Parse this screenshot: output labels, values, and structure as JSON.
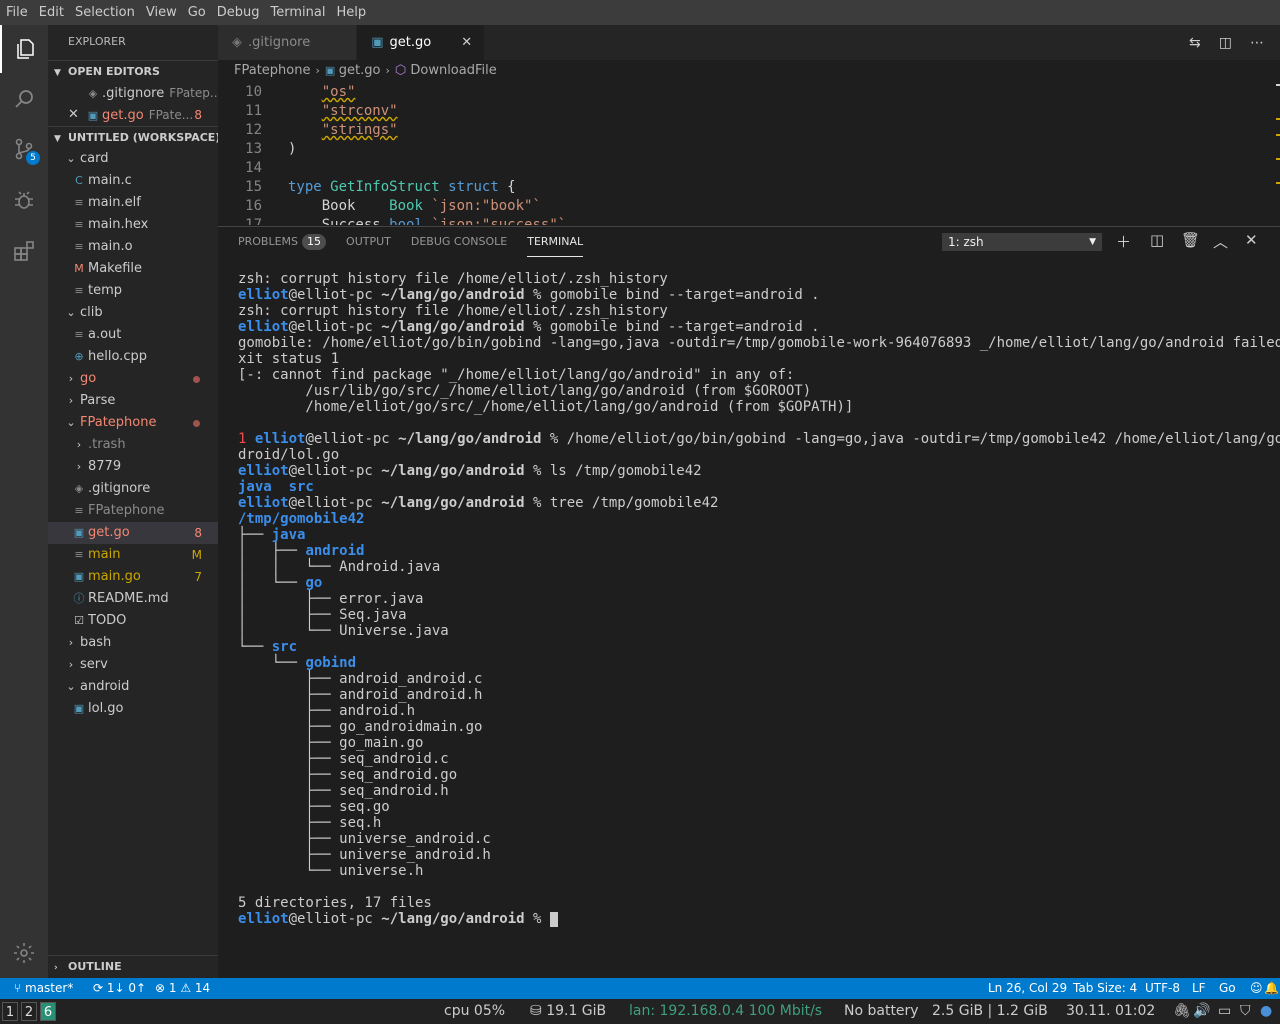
{
  "menu": [
    "File",
    "Edit",
    "Selection",
    "View",
    "Go",
    "Debug",
    "Terminal",
    "Help"
  ],
  "activity": {
    "scm_badge": "5"
  },
  "sidebar": {
    "title": "EXPLORER",
    "open_editors_title": "OPEN EDITORS",
    "open_editors": [
      {
        "name": ".gitignore",
        "dir": "FPatep..."
      },
      {
        "name": "get.go",
        "dir": "FPate...",
        "badge": "8"
      }
    ],
    "workspace_title": "UNTITLED (WORKSPACE)",
    "outline_title": "OUTLINE",
    "tree": [
      {
        "label": "card",
        "type": "folder-open",
        "indent": 1
      },
      {
        "label": "main.c",
        "type": "c",
        "indent": 2
      },
      {
        "label": "main.elf",
        "type": "file",
        "indent": 2
      },
      {
        "label": "main.hex",
        "type": "file",
        "indent": 2
      },
      {
        "label": "main.o",
        "type": "file",
        "indent": 2
      },
      {
        "label": "Makefile",
        "type": "make",
        "indent": 2
      },
      {
        "label": "temp",
        "type": "file",
        "indent": 2
      },
      {
        "label": "clib",
        "type": "folder-open",
        "indent": 1
      },
      {
        "label": "a.out",
        "type": "file",
        "indent": 2
      },
      {
        "label": "hello.cpp",
        "type": "cpp",
        "indent": 2
      },
      {
        "label": "go",
        "type": "folder",
        "indent": 1,
        "status": "dot",
        "color": "red"
      },
      {
        "label": "Parse",
        "type": "folder",
        "indent": 1
      },
      {
        "label": "FPatephone",
        "type": "folder-open",
        "indent": 1,
        "status": "dot",
        "color": "red"
      },
      {
        "label": ".trash",
        "type": "folder",
        "indent": 2,
        "color": "gray"
      },
      {
        "label": "8779",
        "type": "folder",
        "indent": 2
      },
      {
        "label": ".gitignore",
        "type": "git",
        "indent": 2
      },
      {
        "label": "FPatephone",
        "type": "file",
        "indent": 2,
        "color": "gray"
      },
      {
        "label": "get.go",
        "type": "go",
        "indent": 2,
        "color": "red",
        "badge": "8",
        "selected": true
      },
      {
        "label": "main",
        "type": "file",
        "indent": 2,
        "color": "yel",
        "badge": "M"
      },
      {
        "label": "main.go",
        "type": "go",
        "indent": 2,
        "color": "yel",
        "badge": "7"
      },
      {
        "label": "README.md",
        "type": "info",
        "indent": 2
      },
      {
        "label": "TODO",
        "type": "todo",
        "indent": 2
      },
      {
        "label": "bash",
        "type": "folder",
        "indent": 1
      },
      {
        "label": "serv",
        "type": "folder",
        "indent": 1
      },
      {
        "label": "android",
        "type": "folder-open",
        "indent": 1
      },
      {
        "label": "lol.go",
        "type": "go",
        "indent": 2
      }
    ]
  },
  "editor": {
    "tabs": [
      {
        "name": ".gitignore",
        "active": false
      },
      {
        "name": "get.go",
        "active": true
      }
    ],
    "breadcrumb": [
      "FPatephone",
      "get.go",
      "DownloadFile"
    ],
    "lines": [
      {
        "n": "10",
        "html": "    <span class=\"str\">\"os\"</span>"
      },
      {
        "n": "11",
        "html": "    <span class=\"str\">\"strconv\"</span>"
      },
      {
        "n": "12",
        "html": "    <span class=\"str\">\"strings\"</span>"
      },
      {
        "n": "13",
        "html": ")"
      },
      {
        "n": "14",
        "html": ""
      },
      {
        "n": "15",
        "html": "<span class=\"kw\">type</span> <span class=\"ty\">GetInfoStruct</span> <span class=\"kw\">struct</span> {"
      },
      {
        "n": "16",
        "html": "    Book    <span class=\"ty\">Book</span> <span style=\"color:#ce9178\">`json:\"book\"`</span>"
      },
      {
        "n": "17",
        "html": "    Success <span class=\"kw\">bool</span> <span style=\"color:#ce9178\">`json:\"success\"`</span>"
      }
    ]
  },
  "panel": {
    "tabs": [
      "PROBLEMS",
      "OUTPUT",
      "DEBUG CONSOLE",
      "TERMINAL"
    ],
    "problems_count": "15",
    "terminal_select": "1: zsh"
  },
  "terminal_lines": [
    [
      {
        "t": "zsh: corrupt history file /home/elliot/.zsh_history"
      }
    ],
    [
      {
        "t": "elliot",
        "c": "u"
      },
      {
        "t": "@elliot-pc "
      },
      {
        "t": "~/lang/go/android",
        "c": "p"
      },
      {
        "t": " % gomobile bind --target=android ."
      }
    ],
    [
      {
        "t": "zsh: corrupt history file /home/elliot/.zsh_history"
      }
    ],
    [
      {
        "t": "elliot",
        "c": "u"
      },
      {
        "t": "@elliot-pc "
      },
      {
        "t": "~/lang/go/android",
        "c": "p"
      },
      {
        "t": " % gomobile bind --target=android ."
      }
    ],
    [
      {
        "t": "gomobile: /home/elliot/go/bin/gobind -lang=go,java -outdir=/tmp/gomobile-work-964076893 _/home/elliot/lang/go/android failed: e"
      }
    ],
    [
      {
        "t": "xit status 1"
      }
    ],
    [
      {
        "t": "[-: cannot find package \"_/home/elliot/lang/go/android\" in any of:"
      }
    ],
    [
      {
        "t": "        /usr/lib/go/src/_/home/elliot/lang/go/android (from $GOROOT)"
      }
    ],
    [
      {
        "t": "        /home/elliot/go/src/_/home/elliot/lang/go/android (from $GOPATH)]"
      }
    ],
    [
      {
        "t": ""
      }
    ],
    [
      {
        "t": "1 ",
        "c": "err"
      },
      {
        "t": "elliot",
        "c": "u"
      },
      {
        "t": "@elliot-pc "
      },
      {
        "t": "~/lang/go/android",
        "c": "p"
      },
      {
        "t": " % /home/elliot/go/bin/gobind -lang=go,java -outdir=/tmp/gomobile42 /home/elliot/lang/go/an"
      }
    ],
    [
      {
        "t": "droid/lol.go"
      }
    ],
    [
      {
        "t": "elliot",
        "c": "u"
      },
      {
        "t": "@elliot-pc "
      },
      {
        "t": "~/lang/go/android",
        "c": "p"
      },
      {
        "t": " % ls /tmp/gomobile42"
      }
    ],
    [
      {
        "t": "java",
        "c": "d"
      },
      {
        "t": "  "
      },
      {
        "t": "src",
        "c": "d"
      }
    ],
    [
      {
        "t": "elliot",
        "c": "u"
      },
      {
        "t": "@elliot-pc "
      },
      {
        "t": "~/lang/go/android",
        "c": "p"
      },
      {
        "t": " % tree /tmp/gomobile42"
      }
    ],
    [
      {
        "t": "/tmp/gomobile42",
        "c": "d"
      }
    ],
    [
      {
        "t": "├── "
      },
      {
        "t": "java",
        "c": "d"
      }
    ],
    [
      {
        "t": "│   ├── "
      },
      {
        "t": "android",
        "c": "d"
      }
    ],
    [
      {
        "t": "│   │   └── Android.java"
      }
    ],
    [
      {
        "t": "│   └── "
      },
      {
        "t": "go",
        "c": "d"
      }
    ],
    [
      {
        "t": "│       ├── error.java"
      }
    ],
    [
      {
        "t": "│       ├── Seq.java"
      }
    ],
    [
      {
        "t": "│       └── Universe.java"
      }
    ],
    [
      {
        "t": "└── "
      },
      {
        "t": "src",
        "c": "d"
      }
    ],
    [
      {
        "t": "    └── "
      },
      {
        "t": "gobind",
        "c": "d"
      }
    ],
    [
      {
        "t": "        ├── android_android.c"
      }
    ],
    [
      {
        "t": "        ├── android_android.h"
      }
    ],
    [
      {
        "t": "        ├── android.h"
      }
    ],
    [
      {
        "t": "        ├── go_androidmain.go"
      }
    ],
    [
      {
        "t": "        ├── go_main.go"
      }
    ],
    [
      {
        "t": "        ├── seq_android.c"
      }
    ],
    [
      {
        "t": "        ├── seq_android.go"
      }
    ],
    [
      {
        "t": "        ├── seq_android.h"
      }
    ],
    [
      {
        "t": "        ├── seq.go"
      }
    ],
    [
      {
        "t": "        ├── seq.h"
      }
    ],
    [
      {
        "t": "        ├── universe_android.c"
      }
    ],
    [
      {
        "t": "        ├── universe_android.h"
      }
    ],
    [
      {
        "t": "        └── universe.h"
      }
    ],
    [
      {
        "t": ""
      }
    ],
    [
      {
        "t": "5 directories, 17 files"
      }
    ],
    [
      {
        "t": "elliot",
        "c": "u"
      },
      {
        "t": "@elliot-pc "
      },
      {
        "t": "~/lang/go/android",
        "c": "p"
      },
      {
        "t": " % "
      },
      {
        "cursor": true
      }
    ]
  ],
  "status": {
    "branch": "master*",
    "sync": "1↓ 0↑",
    "errors": "1",
    "warnings": "14",
    "position": "Ln 26, Col 29",
    "tab_size": "Tab Size: 4",
    "encoding": "UTF-8",
    "eol": "LF",
    "language": "Go"
  },
  "taskbar": {
    "workspaces": [
      "1",
      "2",
      "6"
    ],
    "cpu": "cpu   05%",
    "disk": "19.1 GiB",
    "lan": "lan: 192.168.0.4 100 Mbit/s",
    "battery": "No battery",
    "mem": "2.5 GiB | 1.2 GiB",
    "clock": "30.11. 01:02"
  }
}
